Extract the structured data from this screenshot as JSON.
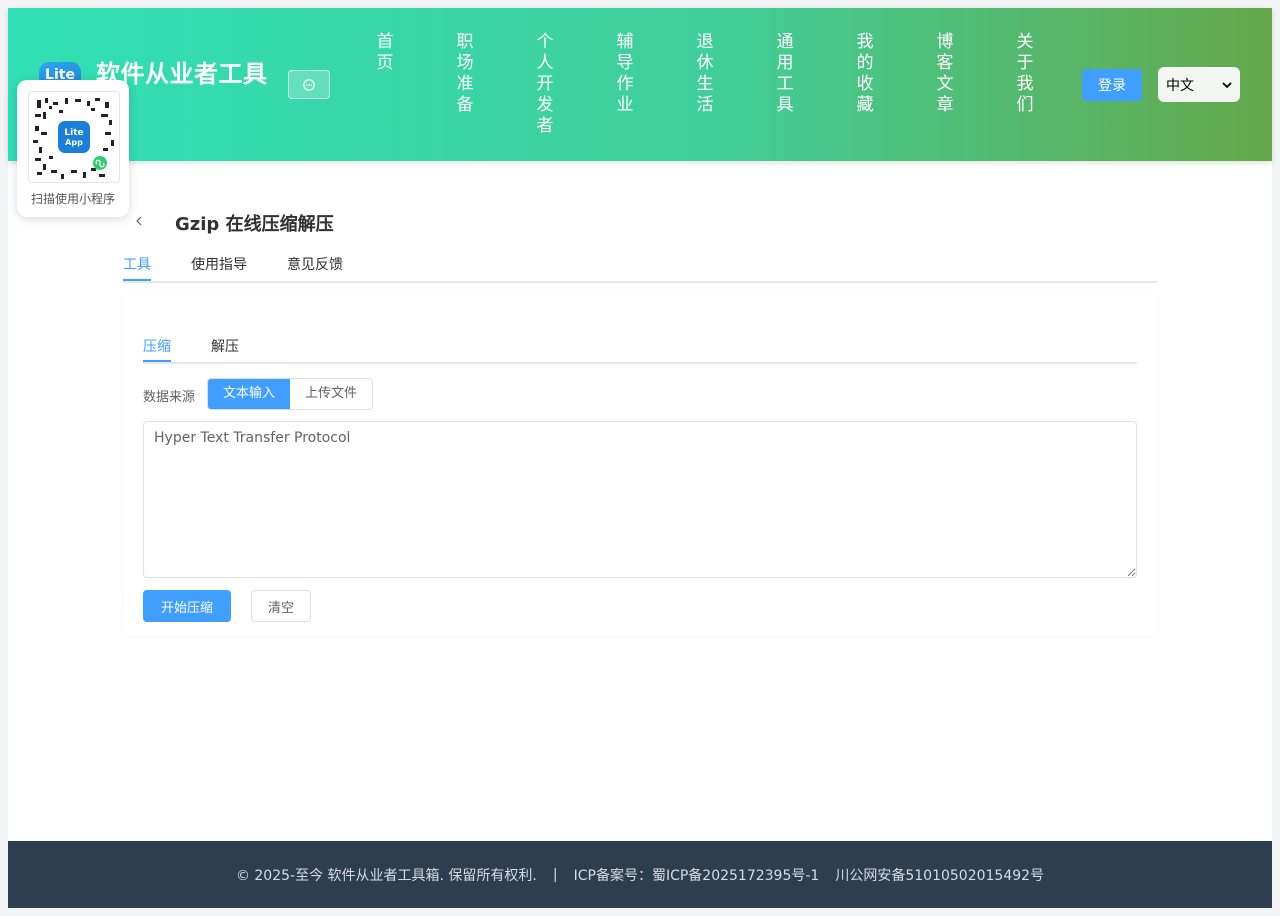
{
  "header": {
    "logo_text": "Lite",
    "site_title": "软件从业者工具",
    "nav": [
      "首页",
      "职场准备",
      "个人开发者",
      "辅导作业",
      "退休生活",
      "通用工具",
      "我的收藏",
      "博客文章",
      "关于我们"
    ],
    "login_label": "登录",
    "language": "中文"
  },
  "qr_popup": {
    "caption": "扫描使用小程序"
  },
  "page": {
    "title": "Gzip 在线压缩解压",
    "tabs": [
      "工具",
      "使用指导",
      "意见反馈"
    ],
    "active_tab": "工具"
  },
  "tool": {
    "sub_tabs": [
      "压缩",
      "解压"
    ],
    "active_sub_tab": "压缩",
    "source_label": "数据来源",
    "source_options": [
      "文本输入",
      "上传文件"
    ],
    "selected_source": "文本输入",
    "input_value": "Hyper Text Transfer Protocol",
    "compress_label": "开始压缩",
    "clear_label": "清空"
  },
  "footer": {
    "copyright": "© 2025-至今 软件从业者工具箱. 保留所有权利.",
    "separator": "|",
    "icp": "ICP备案号：蜀ICP备2025172395号-1",
    "police": "川公网安备51010502015492号"
  },
  "colors": {
    "accent": "#409eff",
    "header_gradient_start": "#2fe0b4",
    "header_gradient_end": "#64a84a",
    "footer_bg": "#2c3e50"
  }
}
